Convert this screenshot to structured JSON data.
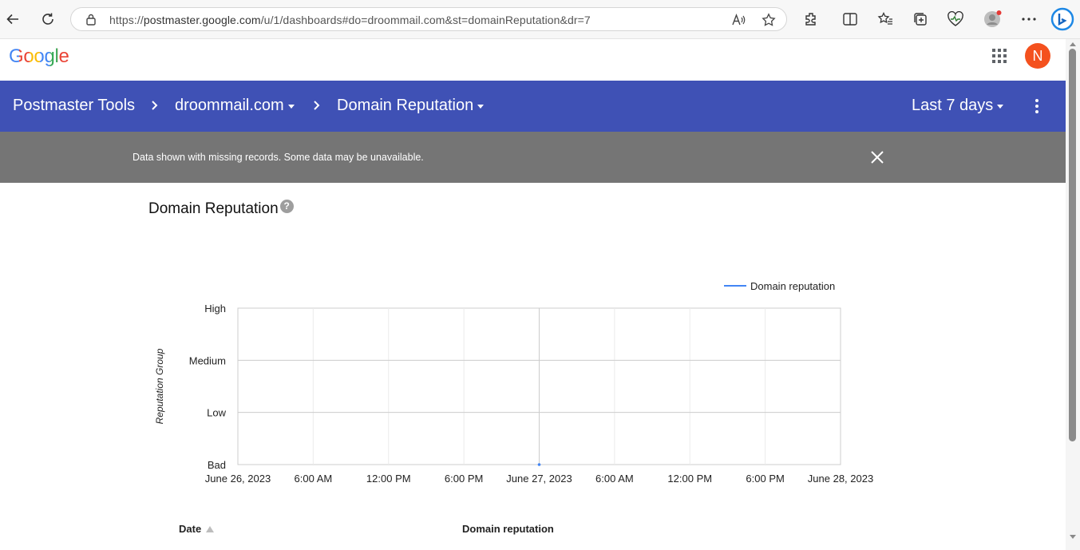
{
  "browser": {
    "url_prefix": "https://",
    "url_host": "postmaster.google.com",
    "url_path": "/u/1/dashboards#do=droommail.com&st=domainReputation&dr=7"
  },
  "header": {
    "logo": "Google",
    "avatar_initial": "N"
  },
  "appbar": {
    "product": "Postmaster Tools",
    "domain": "droommail.com",
    "dashboard": "Domain Reputation",
    "range": "Last 7 days"
  },
  "banner": {
    "message": "Data shown with missing records. Some data may be unavailable."
  },
  "section": {
    "title": "Domain Reputation"
  },
  "chart_data": {
    "type": "line",
    "title": "",
    "ylabel": "Reputation Group",
    "xlabel": "",
    "y_categories": [
      "Bad",
      "Low",
      "Medium",
      "High"
    ],
    "x_ticks": [
      "June 26, 2023",
      "6:00 AM",
      "12:00 PM",
      "6:00 PM",
      "June 27, 2023",
      "6:00 AM",
      "12:00 PM",
      "6:00 PM",
      "June 28, 2023"
    ],
    "xlim": [
      "June 26, 2023",
      "June 28, 2023"
    ],
    "grid": true,
    "legend_position": "top-right",
    "series": [
      {
        "name": "Domain reputation",
        "color": "#4285f4",
        "points": [
          {
            "x": "June 27, 2023",
            "y": "Bad"
          }
        ]
      }
    ]
  },
  "table": {
    "columns": [
      "Date",
      "Domain reputation"
    ]
  },
  "colors": {
    "appbar": "#3f51b5",
    "banner": "#757575",
    "avatar": "#f4511e",
    "series": "#4285f4"
  }
}
